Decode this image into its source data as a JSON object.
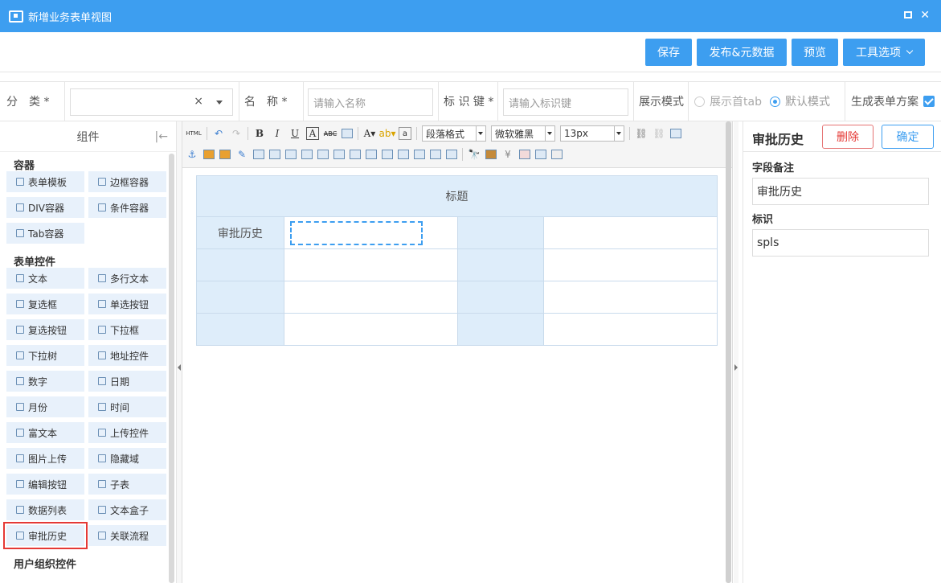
{
  "window": {
    "title": "新增业务表单视图"
  },
  "actions": {
    "save": "保存",
    "publish": "发布&元数据",
    "preview": "预览",
    "tools": "工具选项"
  },
  "props": {
    "category_label": "分　类 *",
    "name_label": "名　称 *",
    "name_placeholder": "请输入名称",
    "key_label": "标 识 键 *",
    "key_placeholder": "请输入标识键",
    "display_mode_label": "展示模式",
    "mode_first_tab": "展示首tab",
    "mode_default": "默认模式",
    "generate_scheme_label": "生成表单方案",
    "clear": "×"
  },
  "left_panel": {
    "title": "组件",
    "collapse": "|←",
    "sections": [
      {
        "title": "容器",
        "items": [
          "表单模板",
          "边框容器",
          "DIV容器",
          "条件容器",
          "Tab容器"
        ]
      },
      {
        "title": "表单控件",
        "items": [
          "文本",
          "多行文本",
          "复选框",
          "单选按钮",
          "复选按钮",
          "下拉框",
          "下拉树",
          "地址控件",
          "数字",
          "日期",
          "月份",
          "时间",
          "富文本",
          "上传控件",
          "图片上传",
          "隐藏域",
          "编辑按钮",
          "子表",
          "数据列表",
          "文本盒子",
          "审批历史",
          "关联流程"
        ]
      },
      {
        "title": "用户组织控件",
        "items": []
      }
    ],
    "selected_item": "审批历史"
  },
  "toolbar": {
    "html": "HTML",
    "bold": "B",
    "italic": "I",
    "underline": "U",
    "paragraph_format": "段落格式",
    "font_family": "微软雅黑",
    "font_size": "13px"
  },
  "form": {
    "heading": "标题",
    "row1_label": "审批历史"
  },
  "right_panel": {
    "title": "审批历史",
    "delete": "删除",
    "confirm": "确定",
    "remark_label": "字段备注",
    "remark_value": "审批历史",
    "id_label": "标识",
    "id_value": "spls"
  },
  "colors": {
    "accent": "#3d9ef0",
    "danger": "#e53935",
    "cell_bg": "#deedfa"
  }
}
